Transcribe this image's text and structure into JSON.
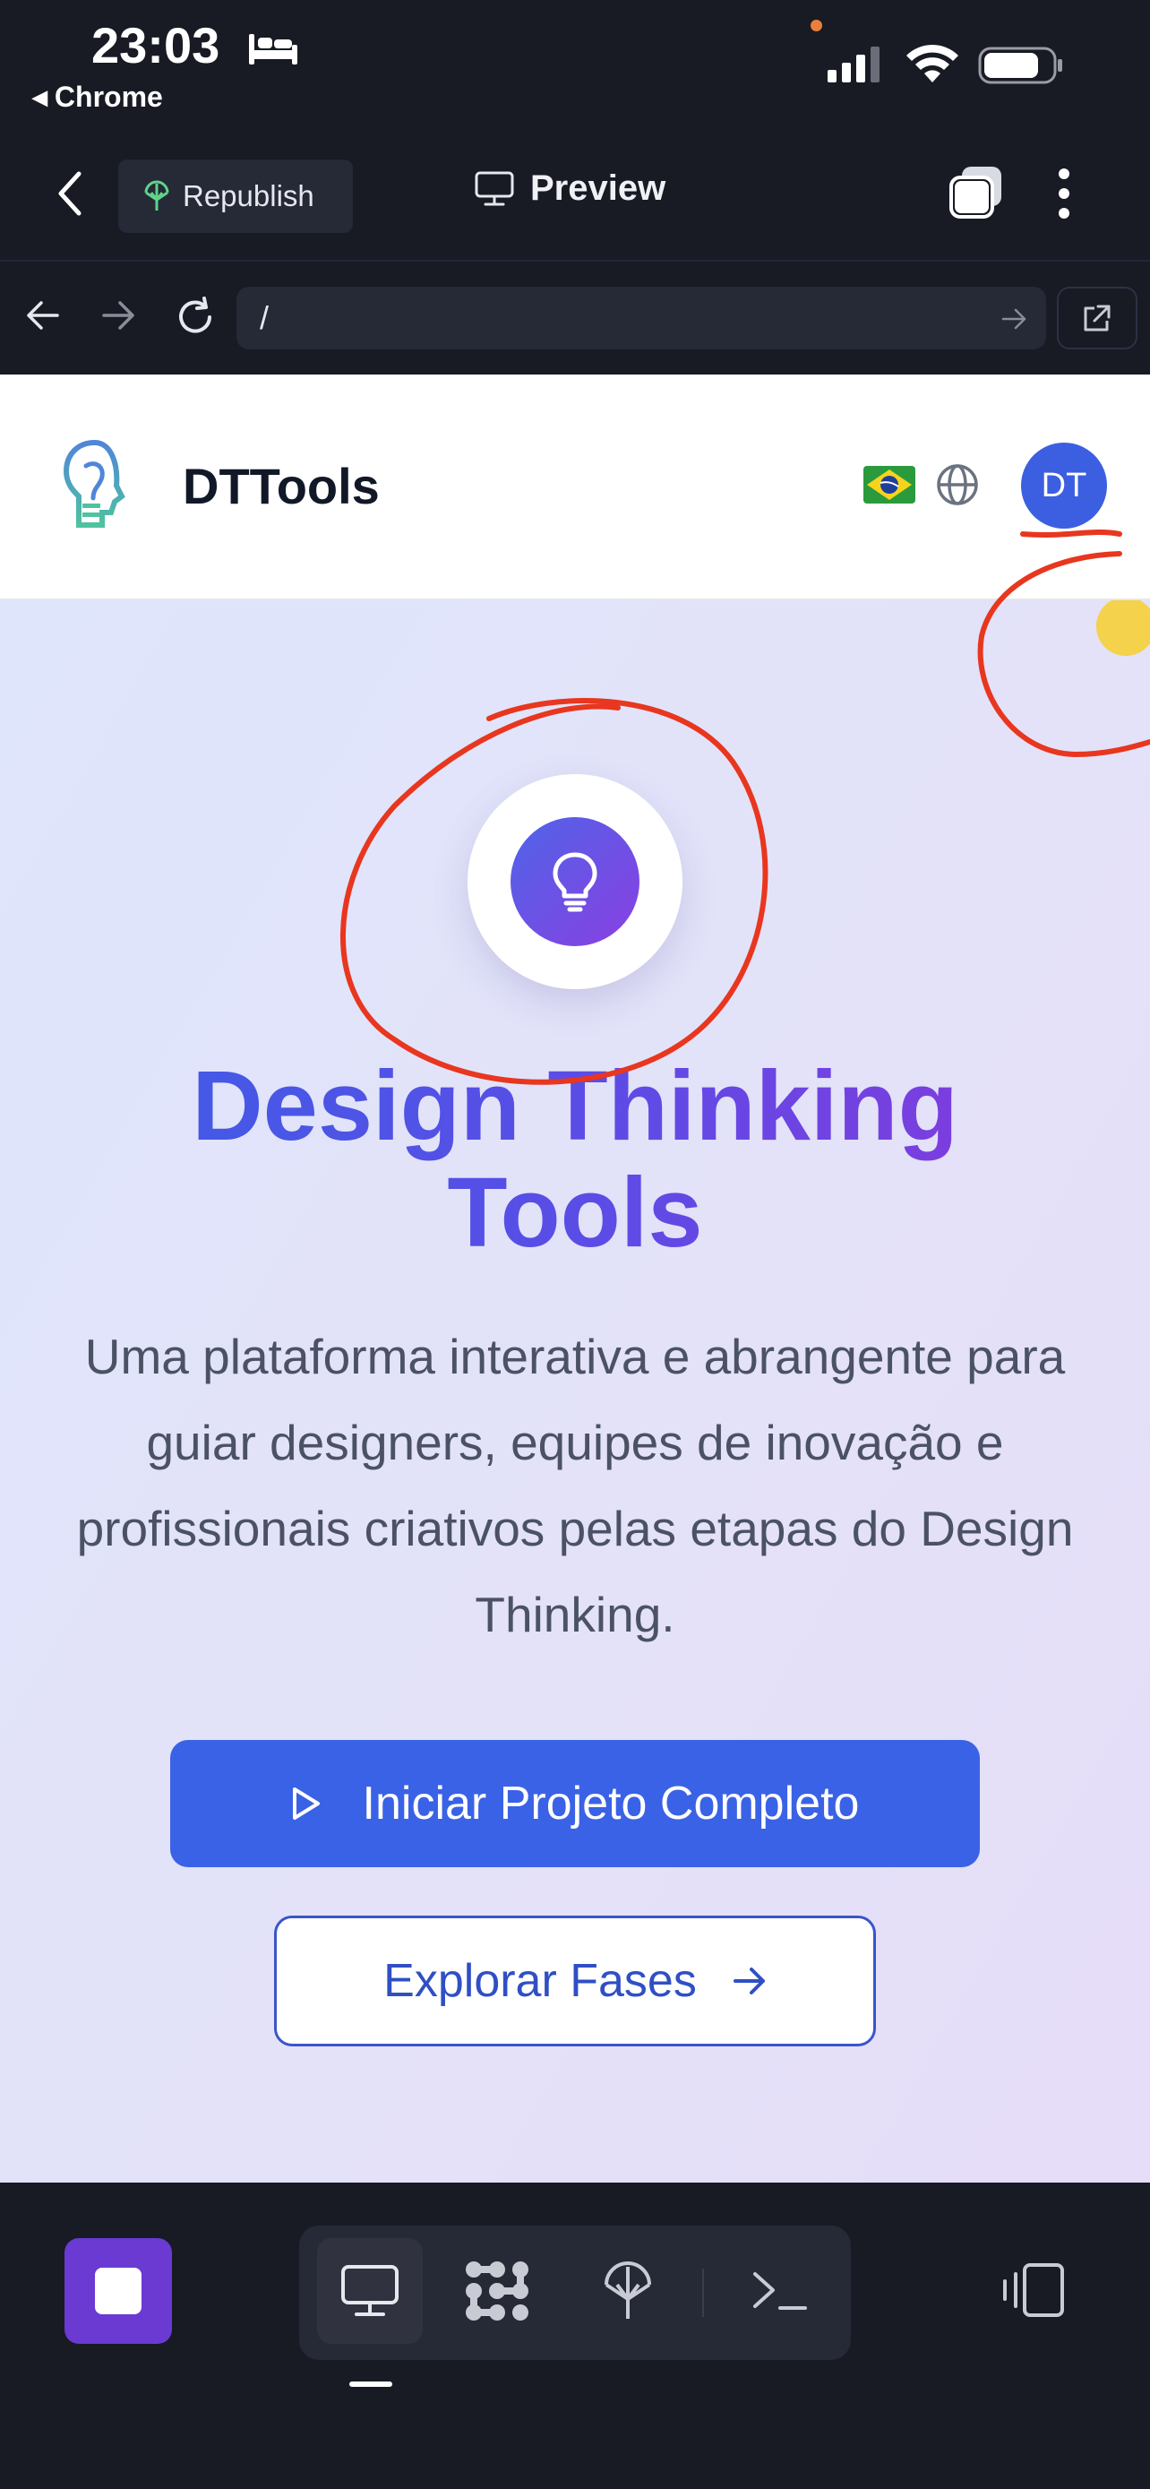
{
  "status_bar": {
    "time": "23:03",
    "back_app": "Chrome",
    "icons": [
      "bed-icon",
      "cellular-signal-icon",
      "wifi-icon",
      "battery-icon"
    ]
  },
  "toolbar": {
    "republish_label": "Republish",
    "preview_label": "Preview",
    "icons": [
      "back-chevron-icon",
      "deploy-icon",
      "monitor-icon",
      "tabs-icon",
      "more-vertical-icon"
    ]
  },
  "url_bar": {
    "url_value": "/",
    "icons": [
      "arrow-left-icon",
      "arrow-right-icon",
      "reload-icon",
      "go-arrow-icon",
      "external-link-icon"
    ]
  },
  "site": {
    "brand": "DTTools",
    "avatar_initials": "DT",
    "icons": [
      "head-lightbulb-logo",
      "brazil-flag-icon",
      "globe-icon"
    ]
  },
  "hero": {
    "title_line1": "Design Thinking",
    "title_line2": "Tools",
    "subtitle": "Uma plataforma interativa e abrangente para guiar designers, equipes de inovação e profissionais criativos pelas etapas do Design Thinking.",
    "primary_button": "Iniciar Projeto Completo",
    "secondary_button": "Explorar Fases",
    "icons": [
      "lightbulb-icon",
      "play-icon",
      "arrow-right-icon"
    ]
  },
  "bottom_bar": {
    "icons": [
      "stop-icon",
      "monitor-icon",
      "workflow-icon",
      "deploy-icon",
      "terminal-icon",
      "device-toggle-icon"
    ],
    "active_tab": "monitor"
  },
  "colors": {
    "dark_bg": "#181a24",
    "accent_blue": "#3a62e6",
    "accent_purple": "#8c36dc",
    "stop_purple": "#6a3ad2",
    "annotation_red": "#e8361f"
  }
}
